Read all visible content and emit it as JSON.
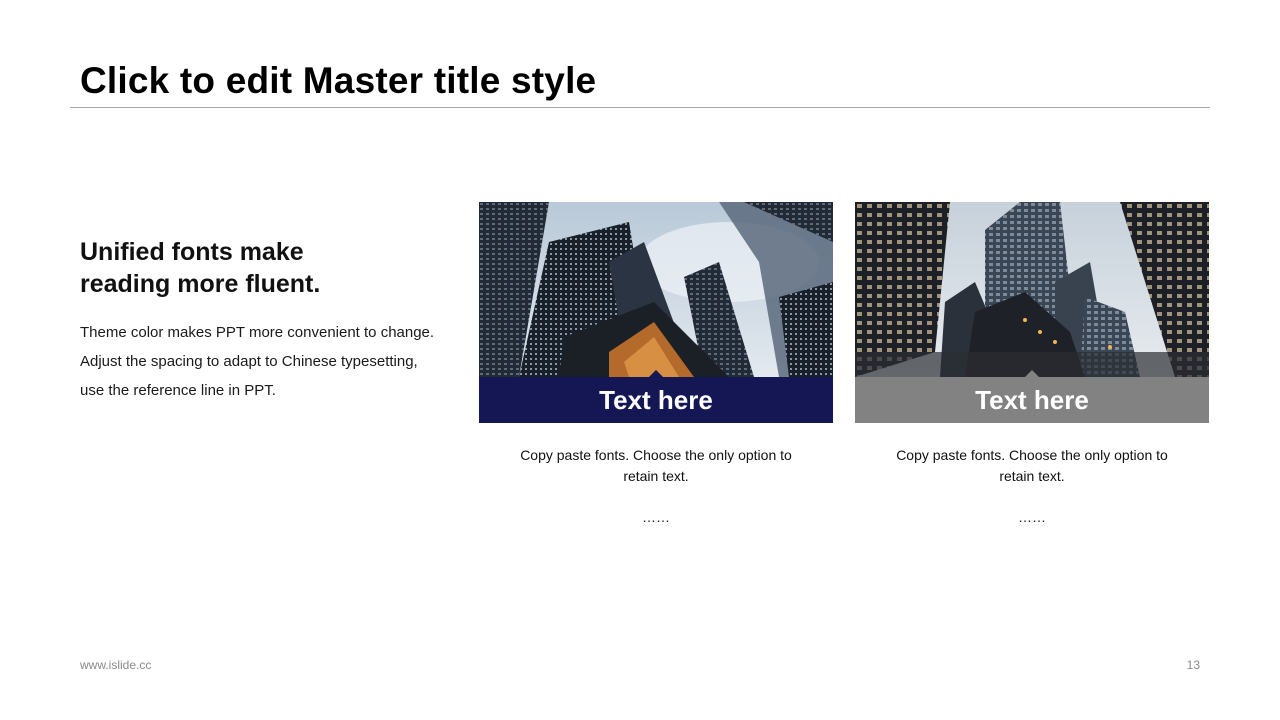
{
  "slide": {
    "title": "Click to edit Master title style",
    "lead": {
      "heading_lines": [
        "Unified fonts make",
        "reading more fluent."
      ],
      "body_lines": [
        "Theme color makes PPT more convenient to change.",
        "Adjust the spacing to adapt to Chinese typesetting,",
        "use the reference line in PPT."
      ]
    },
    "cards": [
      {
        "image": "city-skyscrapers-photo",
        "banner_text": "Text here",
        "banner_color": "#151654",
        "description_lines": [
          "Copy paste fonts. Choose the only option to",
          "retain text."
        ],
        "ellipsis": "……"
      },
      {
        "image": "city-street-towers-photo",
        "banner_text": "Text here",
        "banner_color": "#828282",
        "description_lines": [
          "Copy paste fonts. Choose the only option to",
          "retain text."
        ],
        "ellipsis": "……"
      }
    ],
    "footer": {
      "url": "www.islide.cc",
      "page_number": "13"
    }
  }
}
